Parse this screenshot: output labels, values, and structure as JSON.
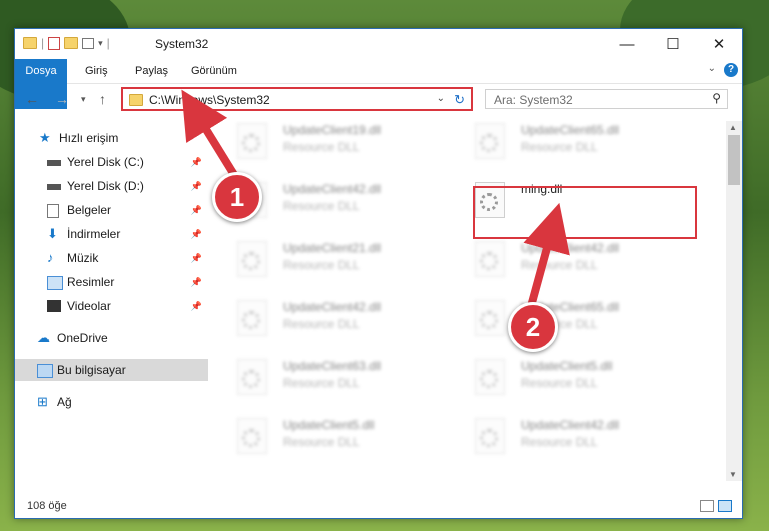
{
  "window": {
    "title": "System32",
    "controls": {
      "minimize": "—",
      "maximize": "☐",
      "close": "✕"
    }
  },
  "ribbon": {
    "tabs": [
      "Dosya",
      "Giriş",
      "Paylaş",
      "Görünüm"
    ],
    "help": "?"
  },
  "navigation": {
    "address_path": "C:\\Windows\\System32",
    "search_placeholder": "Ara: System32"
  },
  "sidebar": {
    "items": [
      {
        "label": "Hızlı erişim",
        "icon": "star-icon",
        "pinned": false
      },
      {
        "label": "Yerel Disk (C:)",
        "icon": "drive-icon",
        "pinned": true
      },
      {
        "label": "Yerel Disk (D:)",
        "icon": "drive-icon",
        "pinned": true
      },
      {
        "label": "Belgeler",
        "icon": "document-icon",
        "pinned": true
      },
      {
        "label": "İndirmeler",
        "icon": "download-icon",
        "pinned": true
      },
      {
        "label": "Müzik",
        "icon": "music-icon",
        "pinned": true
      },
      {
        "label": "Resimler",
        "icon": "pictures-icon",
        "pinned": true
      },
      {
        "label": "Videolar",
        "icon": "video-icon",
        "pinned": true
      },
      {
        "label": "OneDrive",
        "icon": "cloud-icon",
        "pinned": false
      },
      {
        "label": "Bu bilgisayar",
        "icon": "computer-icon",
        "pinned": false,
        "selected": true
      },
      {
        "label": "Ağ",
        "icon": "network-icon",
        "pinned": false
      }
    ]
  },
  "files": {
    "left_column": [
      {
        "name": "UpdateClient19.dll",
        "type": "Resource DLL"
      },
      {
        "name": "UpdateClient42.dll",
        "type": "Resource DLL"
      },
      {
        "name": "UpdateClient21.dll",
        "type": "Resource DLL"
      },
      {
        "name": "UpdateClient42.dll",
        "type": "Resource DLL"
      },
      {
        "name": "UpdateClient63.dll",
        "type": "Resource DLL"
      },
      {
        "name": "UpdateClient5.dll",
        "type": "Resource DLL"
      }
    ],
    "right_column": [
      {
        "name": "UpdateClient65.dll",
        "type": "Resource DLL"
      },
      {
        "name": "ming.dll",
        "type": ""
      },
      {
        "name": "UpdateClient42.dll",
        "type": "Resource DLL"
      },
      {
        "name": "UpdateClient65.dll",
        "type": "Resource DLL"
      },
      {
        "name": "UpdateClient5.dll",
        "type": "Resource DLL"
      },
      {
        "name": "UpdateClient42.dll",
        "type": "Resource DLL"
      }
    ]
  },
  "status": {
    "count": "108 öğe"
  },
  "annotations": {
    "step1": "1",
    "step2": "2"
  },
  "colors": {
    "accent": "#1979ca",
    "highlight": "#d9363e"
  }
}
